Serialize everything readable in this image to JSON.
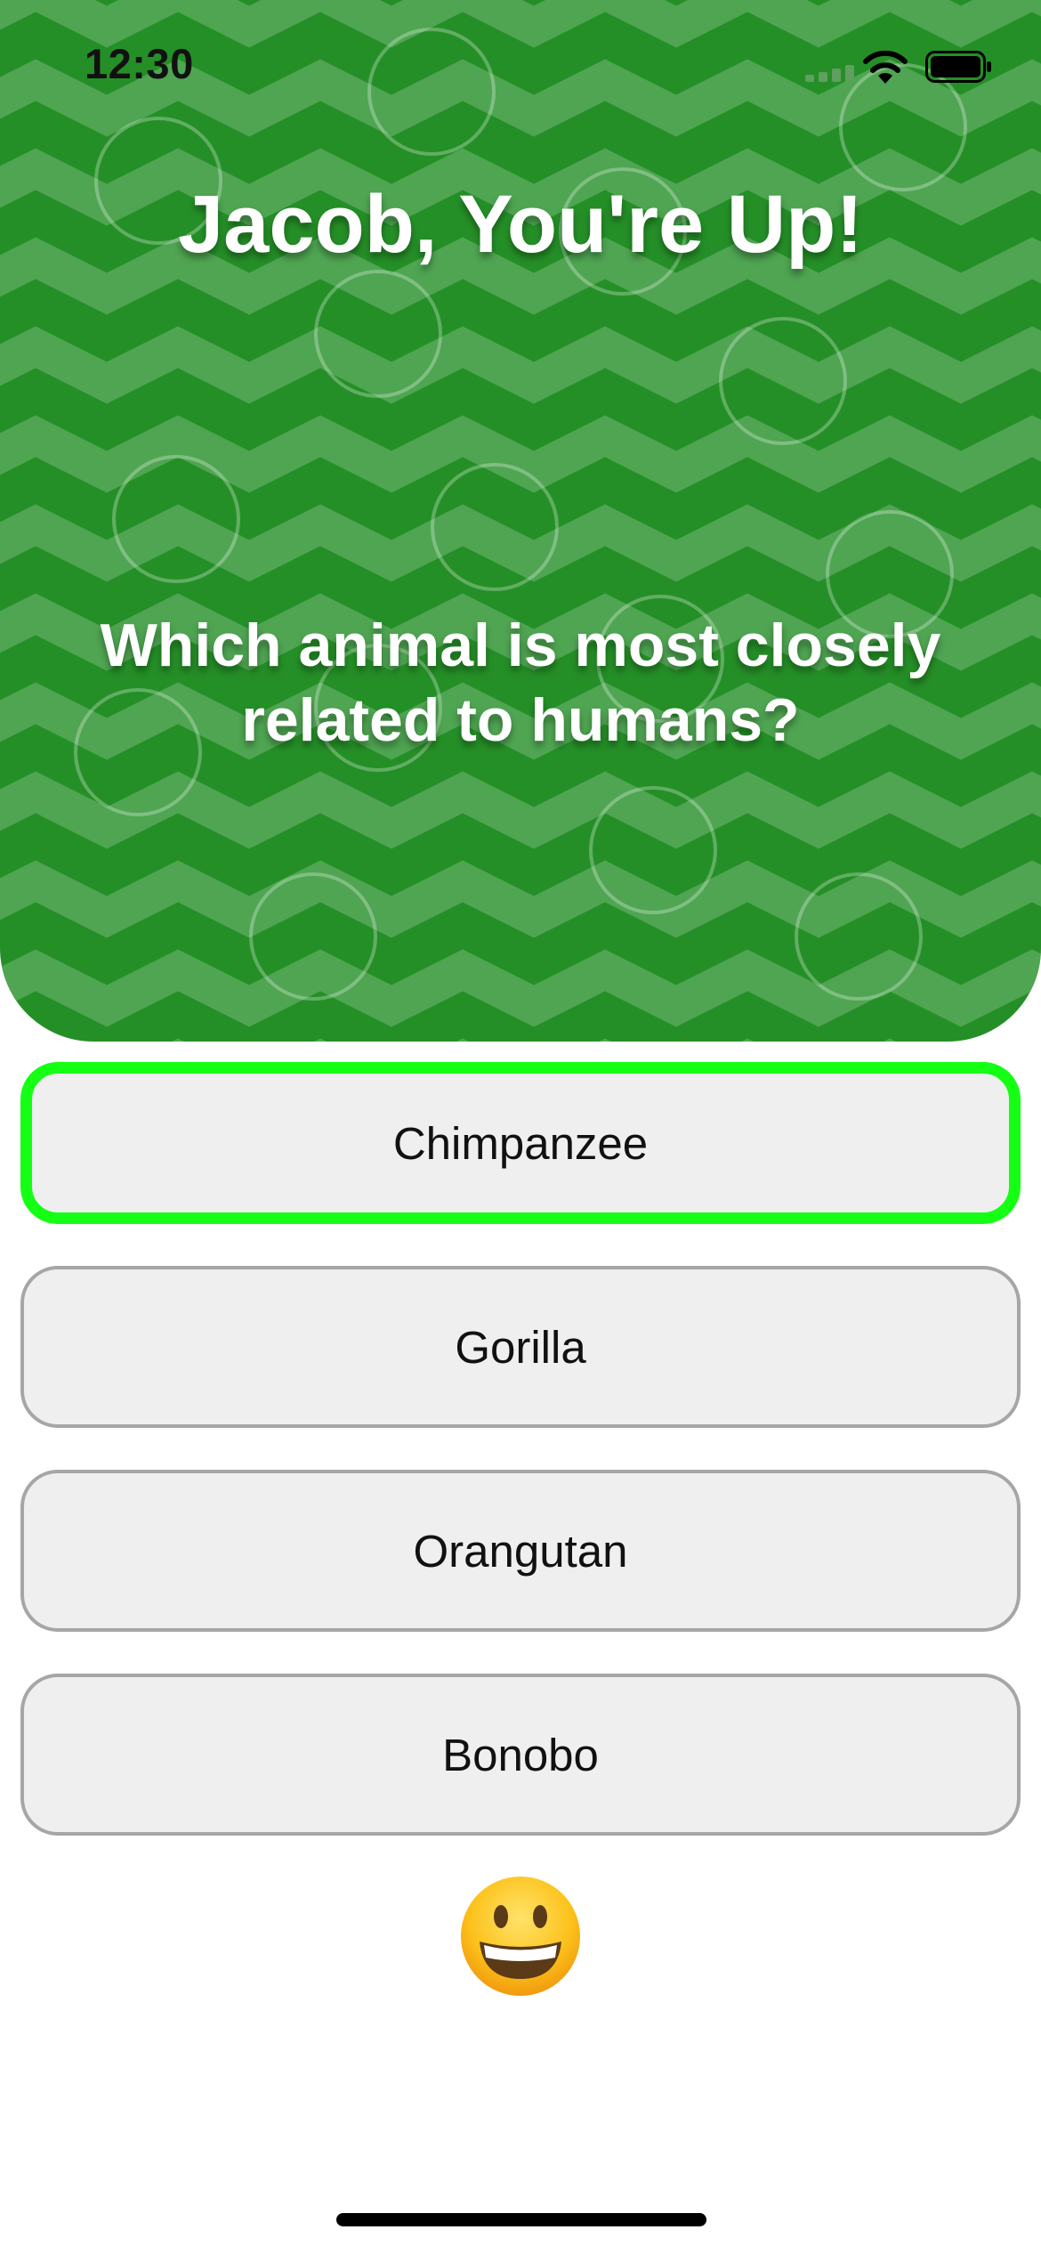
{
  "status_bar": {
    "time": "12:30"
  },
  "header": {
    "player_title": "Jacob, You're Up!",
    "question": "Which animal is most closely related to humans?",
    "background_color": "#258f27",
    "stripe_color": "#4fa552"
  },
  "answers": [
    {
      "label": "Chimpanzee",
      "selected": true
    },
    {
      "label": "Gorilla",
      "selected": false
    },
    {
      "label": "Orangutan",
      "selected": false
    },
    {
      "label": "Bonobo",
      "selected": false
    }
  ],
  "colors": {
    "selected_border": "#14ff14",
    "answer_border": "#a6a6a6",
    "answer_background": "#efefef"
  },
  "reaction": {
    "icon": "grinning-face-emoji"
  }
}
